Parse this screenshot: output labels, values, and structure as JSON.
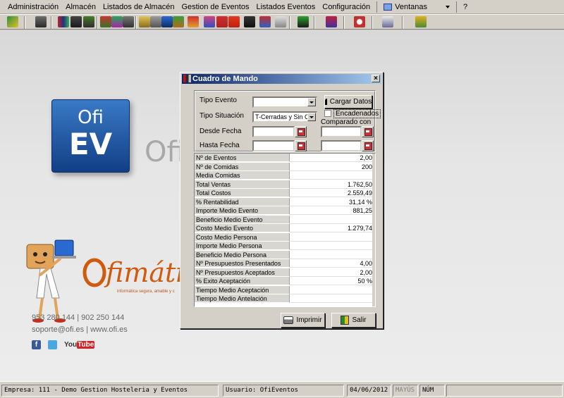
{
  "menu": {
    "items": [
      "Administración",
      "Almacén",
      "Listados de Almacén",
      "Gestion de Eventos",
      "Listados Eventos",
      "Configuración"
    ],
    "ventanas": "Ventanas",
    "help": "?"
  },
  "toolbar": {
    "buttons": [
      "modules-icon",
      "window-icon",
      "staff-icon",
      "walk-icon",
      "wine-icon",
      "chef-icon",
      "receipt-icon",
      "people-icon",
      "copy-icon",
      "transfer-icon",
      "book-icon",
      "gift-icon",
      "calendar-icon",
      "cutlery-icon",
      "percent-icon",
      "person-icon",
      "chart-icon",
      "document-icon",
      "tool-icon",
      "alarm-icon",
      "clock-icon",
      "contacts-icon",
      "key-icon"
    ]
  },
  "desktop": {
    "logo_line1": "Ofi",
    "logo_line2": "EV",
    "brand_partial": "Ofi",
    "ofimatica": "fimátic",
    "tagline": "informática segura, amable y c",
    "phones": "953 280 144  |  902 250 144",
    "contact": "soporte@ofi.es  |  www.ofi.es",
    "youtube_you": "You",
    "youtube_tube": "Tube"
  },
  "dialog": {
    "title": "Cuadro de Mando",
    "filters": {
      "tipo_evento_label": "Tipo Evento",
      "tipo_evento_value": "",
      "tipo_situacion_label": "Tipo Situación",
      "tipo_situacion_value": "T-Cerradas y Sin Cer",
      "desde_fecha_label": "Desde Fecha",
      "hasta_fecha_label": "Hasta Fecha",
      "comparado_label": "Comparado con",
      "encadenados_label": "Encadenados",
      "cargar_label": "Cargar Datos"
    },
    "stats": [
      {
        "label": "Nº de Eventos",
        "value": "2,00"
      },
      {
        "label": "Nº de Comidas",
        "value": "200"
      },
      {
        "label": "Media Comidas",
        "value": ""
      },
      {
        "label": "Total Ventas",
        "value": "1.762,50"
      },
      {
        "label": "Total Costos",
        "value": "2.559,49"
      },
      {
        "label": "% Rentabilidad",
        "value": "31,14 %"
      },
      {
        "label": "Importe Medio Evento",
        "value": "881,25"
      },
      {
        "label": "Beneficio Medio Evento",
        "value": ""
      },
      {
        "label": "Costo Medio Evento",
        "value": "1.279,74"
      },
      {
        "label": "Costo Medio Persona",
        "value": ""
      },
      {
        "label": "Importe Medio Persona",
        "value": ""
      },
      {
        "label": "Beneficio Medio Persona",
        "value": ""
      },
      {
        "label": "Nº Presupuestos Presentados",
        "value": "4,00"
      },
      {
        "label": "Nº Presupuestos Aceptados",
        "value": "2,00"
      },
      {
        "label": "% Exito Aceptación",
        "value": "50 %"
      },
      {
        "label": "Tiempo Medio Aceptación",
        "value": ""
      },
      {
        "label": "Tiempo Medio Antelación",
        "value": ""
      }
    ],
    "imprimir_label": "Imprimir",
    "salir_label": "Salir"
  },
  "statusbar": {
    "empresa": "Empresa: 111 - Demo Gestion Hosteleria y Eventos",
    "usuario": "Usuario: OfiEventos",
    "fecha": "04/06/2012",
    "mayus": "MAYÚS",
    "num": "NÚM"
  }
}
